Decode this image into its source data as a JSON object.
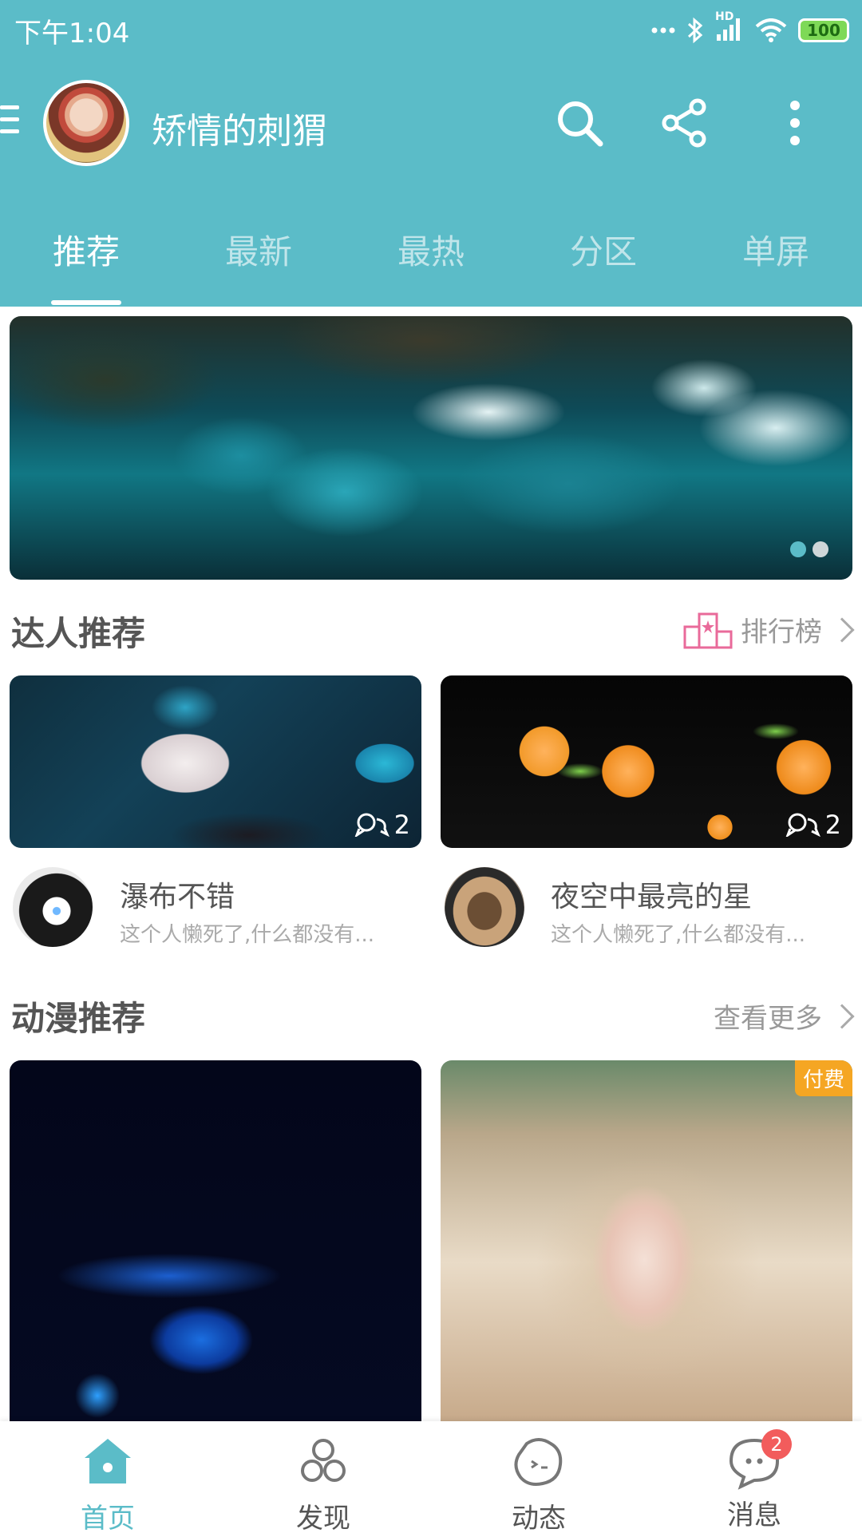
{
  "status_bar": {
    "time": "下午1:04",
    "network_label": "HD",
    "battery": "100",
    "icons": [
      "dots-icon",
      "bluetooth-icon",
      "signal-icon",
      "wifi-icon",
      "battery-icon"
    ]
  },
  "header": {
    "username": "矫情的刺猬",
    "icons": [
      "menu-icon",
      "search-icon",
      "share-icon",
      "more-vertical-icon"
    ],
    "background_color": "#5bbcc8"
  },
  "tabs": [
    {
      "label": "推荐",
      "active": true
    },
    {
      "label": "最新",
      "active": false
    },
    {
      "label": "最热",
      "active": false
    },
    {
      "label": "分区",
      "active": false
    },
    {
      "label": "单屏",
      "active": false
    }
  ],
  "banner": {
    "page_count": 2,
    "active_page": 1
  },
  "experts_section": {
    "title": "达人推荐",
    "more_label": "排行榜",
    "more_icon": "ranking-icon",
    "cards": [
      {
        "comment_count": "2",
        "name": "瀑布不错",
        "desc": "这个人懒死了,什么都没有..."
      },
      {
        "comment_count": "2",
        "name": "夜空中最亮的星",
        "desc": "这个人懒死了,什么都没有..."
      }
    ]
  },
  "anime_section": {
    "title": "动漫推荐",
    "more_label": "查看更多",
    "cards": [
      {
        "tag": ""
      },
      {
        "tag": "付费"
      }
    ]
  },
  "bottom_nav": {
    "items": [
      {
        "label": "首页",
        "icon": "home-icon",
        "active": true
      },
      {
        "label": "发现",
        "icon": "discover-icon",
        "active": false
      },
      {
        "label": "动态",
        "icon": "moments-icon",
        "active": false
      },
      {
        "label": "消息",
        "icon": "message-icon",
        "active": false,
        "badge": "2"
      }
    ]
  },
  "colors": {
    "accent": "#5bbcc8",
    "badge": "#f25c5c",
    "paid_tag": "#f5a623",
    "ranking_icon": "#e96a9a"
  }
}
